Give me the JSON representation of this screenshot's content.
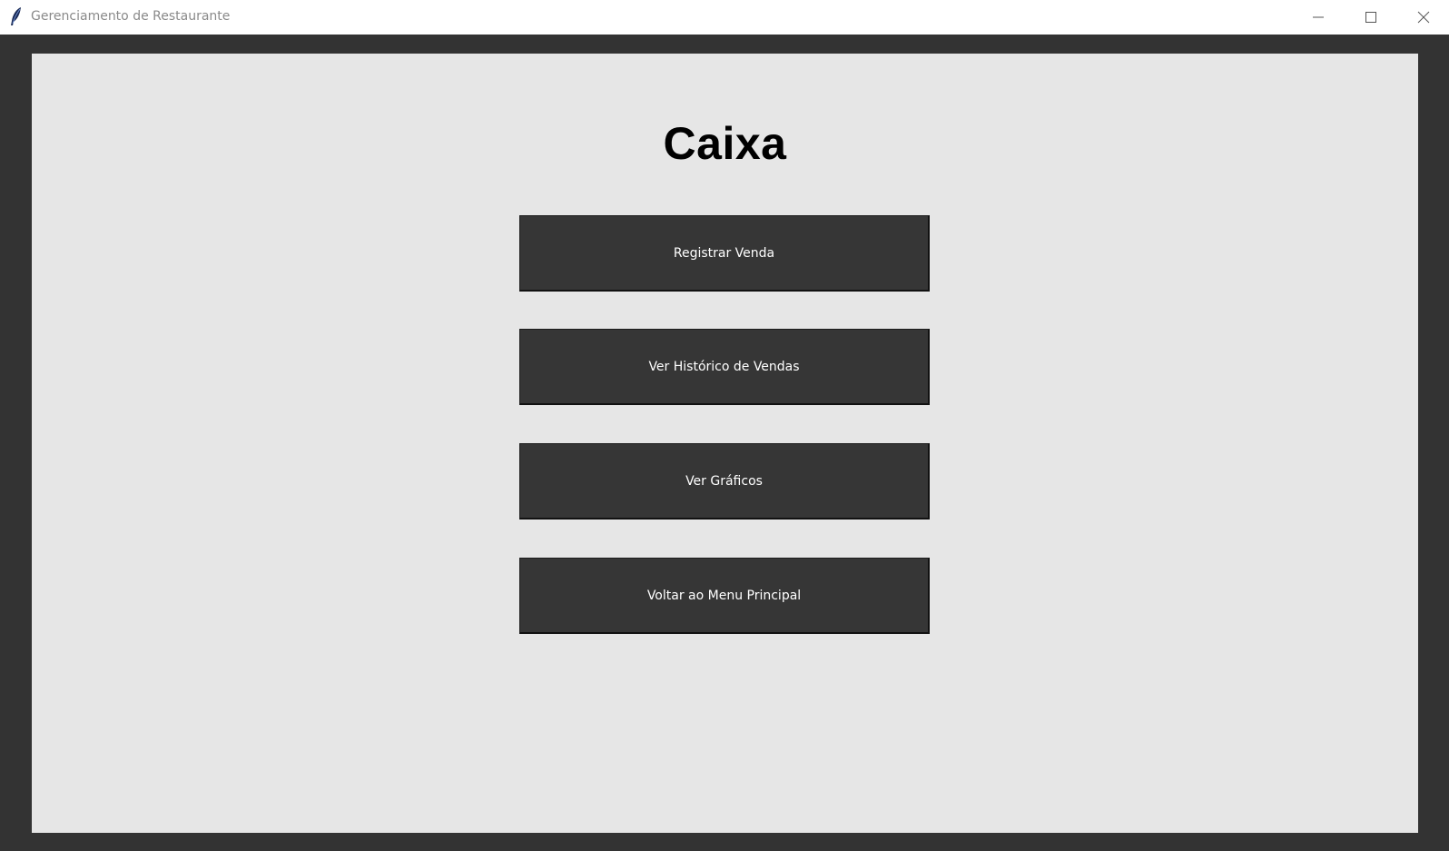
{
  "window": {
    "title": "Gerenciamento de Restaurante",
    "app_icon": "feather-icon",
    "controls": [
      "minimize-icon",
      "maximize-icon",
      "close-icon"
    ]
  },
  "main": {
    "title": "Caixa",
    "buttons": [
      {
        "label": "Registrar Venda"
      },
      {
        "label": "Ver Histórico de Vendas"
      },
      {
        "label": "Ver Gráficos"
      },
      {
        "label": "Voltar ao Menu Principal"
      }
    ]
  },
  "colors": {
    "window_background": "#333333",
    "content_background": "#e6e6e6",
    "button_background": "#363636",
    "button_text": "#ffffff",
    "title_text": "#000000"
  }
}
